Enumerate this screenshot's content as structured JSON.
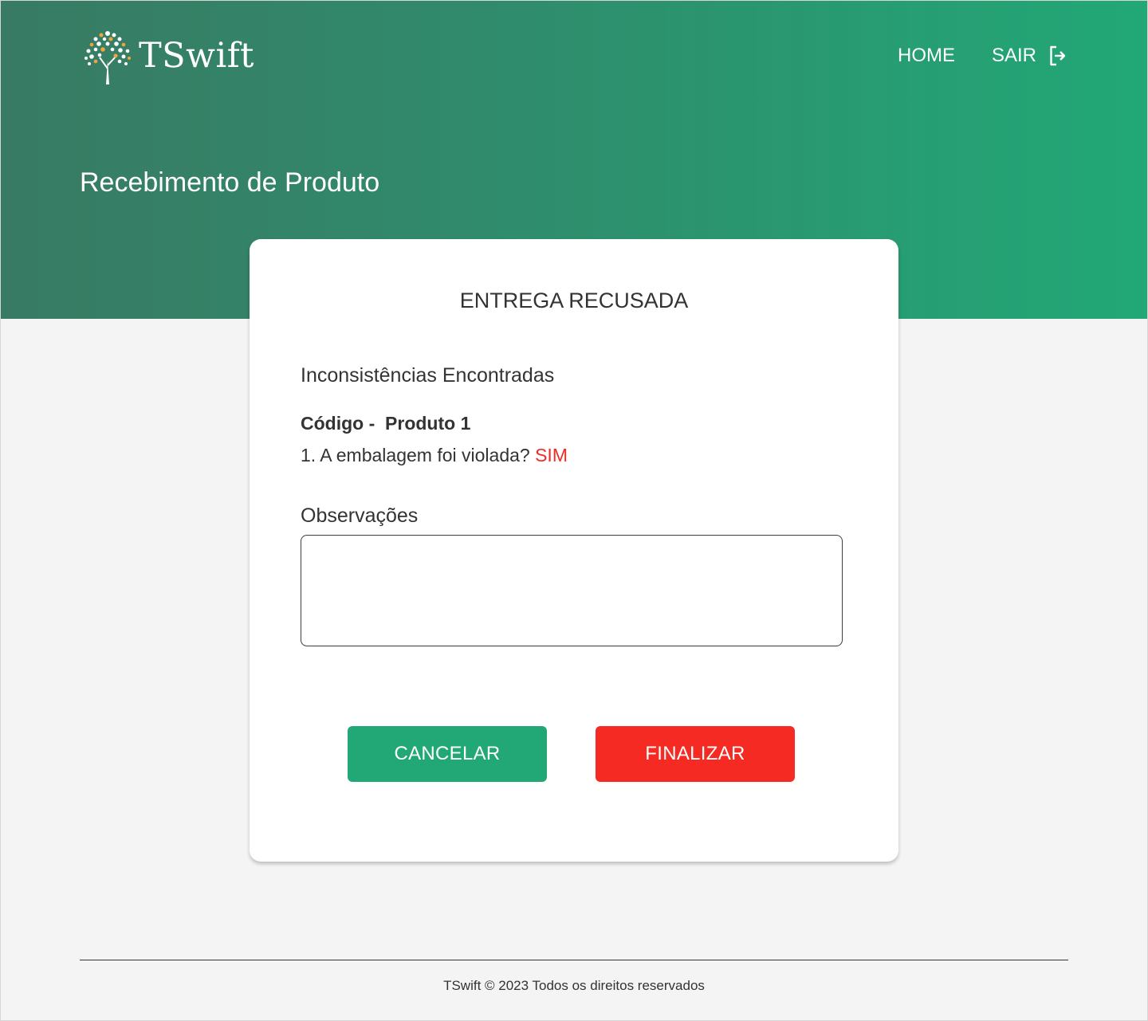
{
  "header": {
    "brand_name": "TSwift",
    "nav": {
      "home_label": "HOME",
      "logout_label": "SAIR"
    }
  },
  "page": {
    "title": "Recebimento de Produto"
  },
  "card": {
    "title": "ENTREGA RECUSADA",
    "inconsistencies_heading": "Inconsistências Encontradas",
    "product_line": "Código -  Produto 1",
    "question": {
      "text": "1. A embalagem foi violada?",
      "answer": "SIM"
    },
    "observations": {
      "label": "Observações",
      "value": "",
      "placeholder": ""
    },
    "buttons": {
      "cancel_label": "CANCELAR",
      "finish_label": "FINALIZAR"
    }
  },
  "footer": {
    "copyright": "TSwift © 2023 Todos os direitos reservados"
  },
  "icons": {
    "logo": "tree-logo-icon",
    "logout": "logout-icon"
  },
  "colors": {
    "primary_green": "#22a877",
    "header_gradient_start": "#387a63",
    "header_gradient_end": "#22a877",
    "danger_red": "#f52a23",
    "text_dark": "#333333",
    "background": "#f4f4f4"
  }
}
